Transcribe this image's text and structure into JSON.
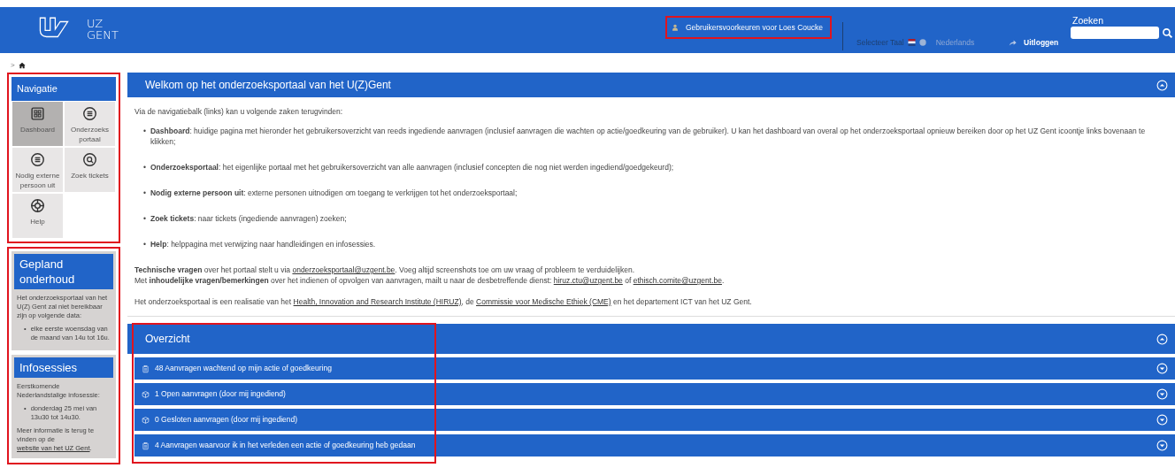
{
  "header": {
    "logo_lines": [
      "UZ",
      "GENT"
    ],
    "user_prefs": "Gebruikersvoorkeuren voor Loes Coucke",
    "language_label": "Selecteer Taal",
    "language": "Nederlands",
    "logout": "Uitloggen",
    "search_label": "Zoeken"
  },
  "breadcrumb": {
    "separator": ">"
  },
  "navigation": {
    "title": "Navigatie",
    "items": [
      {
        "label": "Dashboard",
        "kind": "grid",
        "selected": true
      },
      {
        "label": "Onderzoeks portaal",
        "kind": "list",
        "selected": false
      },
      {
        "label": "Nodig externe persoon uit",
        "kind": "list",
        "selected": false
      },
      {
        "label": "Zoek tickets",
        "kind": "search",
        "selected": false
      },
      {
        "label": "Help",
        "kind": "lifebuoy",
        "selected": false
      }
    ]
  },
  "sidebar_panels": [
    {
      "title": "Gepland onderhoud",
      "intro": "Het onderzoeksportaal van het U(Z) Gent zal niet bereikbaar zijn op volgende data:",
      "marker": "•",
      "bullets": [
        "elke eerste woensdag van de maand van 14u tot 16u."
      ]
    },
    {
      "title": "Infosessies",
      "intro": "Eerstkomende Nederlandstalige infosessie:",
      "marker": "•",
      "bullets": [
        "donderdag 25 mei van 13u30 tot 14u30."
      ],
      "footer": [
        {
          "kind": "text",
          "text": "Meer informatie is terug te vinden op de"
        },
        {
          "kind": "link",
          "text": "website van het UZ Gent"
        },
        {
          "kind": "text",
          "text": "."
        }
      ]
    }
  ],
  "welcome": {
    "title": "Welkom op het onderzoeksportaal van het U(Z)Gent",
    "intro": "Via de navigatiebalk (links) kan u volgende zaken terugvinden:",
    "marker": "•",
    "items": [
      {
        "term": "Dashboard",
        "text": ": huidige pagina met hieronder het gebruikersoverzicht van reeds ingediende aanvragen (inclusief aanvragen die wachten op actie/goedkeuring van de gebruiker). U kan het dashboard van overal op het onderzoeksportaal opnieuw bereiken door op het UZ Gent icoontje links bovenaan te klikken;"
      },
      {
        "term": "Onderzoeksportaal",
        "text": ": het eigenlijke portaal met het gebruikersoverzicht van alle aanvragen (inclusief concepten die nog niet werden ingediend/goedgekeurd);"
      },
      {
        "term": "Nodig externe persoon uit",
        "text": ": externe personen uitnodigen om toegang te verkrijgen tot het onderzoeksportaal;"
      },
      {
        "term": "Zoek tickets",
        "text": ": naar tickets (ingediende aanvragen) zoeken;"
      },
      {
        "term": "Help",
        "text": ": helppagina met verwijzing naar handleidingen en infosessies."
      }
    ],
    "paragraphs": [
      [
        {
          "kind": "bold",
          "text": "Technische vragen"
        },
        {
          "kind": "text",
          "text": " over het portaal stelt u via "
        },
        {
          "kind": "link",
          "text": "onderzoeksportaal@uzgent.be"
        },
        {
          "kind": "text",
          "text": ". Voeg altijd screenshots toe om uw vraag of probleem te verduidelijken."
        }
      ],
      [
        {
          "kind": "text",
          "text": "Met "
        },
        {
          "kind": "bold",
          "text": "inhoudelijke vragen/bemerkingen"
        },
        {
          "kind": "text",
          "text": " over het indienen of opvolgen van aanvragen, mailt u naar de desbetreffende dienst: "
        },
        {
          "kind": "link",
          "text": "hiruz.ctu@uzgent.be"
        },
        {
          "kind": "text",
          "text": " of "
        },
        {
          "kind": "link",
          "text": "ethisch.comite@uzgent.be"
        },
        {
          "kind": "text",
          "text": "."
        }
      ],
      [
        {
          "kind": "text",
          "text": "Het onderzoeksportaal is een realisatie van het "
        },
        {
          "kind": "link",
          "text": "Health, Innovation and Research Institute (HIRUZ)"
        },
        {
          "kind": "text",
          "text": ", de "
        },
        {
          "kind": "link",
          "text": "Commissie voor Medische Ethiek (CME)"
        },
        {
          "kind": "text",
          "text": " en het departement ICT van het UZ Gent."
        }
      ]
    ]
  },
  "overview": {
    "title": "Overzicht",
    "rows": [
      {
        "kind": "clipboard",
        "text": "48 Aanvragen wachtend op mijn actie of goedkeuring"
      },
      {
        "kind": "box",
        "text": "1 Open aanvragen (door mij ingediend)"
      },
      {
        "kind": "box",
        "text": "0 Gesloten aanvragen (door mij ingediend)"
      },
      {
        "kind": "clipboard",
        "text": "4 Aanvragen waarvoor ik in het verleden een actie of goedkeuring heb gedaan"
      }
    ]
  }
}
